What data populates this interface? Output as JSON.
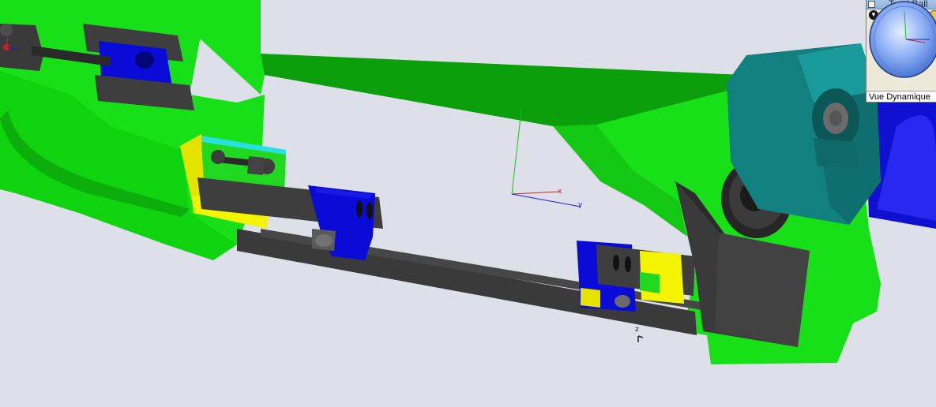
{
  "trackball": {
    "title": "TrackBall",
    "view_label": "Vue Dynamique"
  },
  "axis_triad": {
    "x_label": "x",
    "y_label": "y"
  },
  "small_triad": {
    "label": "z"
  },
  "colors": {
    "background": "#dde0e8",
    "frame_green": "#18e018",
    "frame_dark_green": "#0a9a0a",
    "blade_gray": "#3c3c3c",
    "guide_blue": "#0a0ad8",
    "jaw_yellow": "#f0f000",
    "motor_teal": "#138080",
    "accent_cyan": "#27e0e0"
  }
}
